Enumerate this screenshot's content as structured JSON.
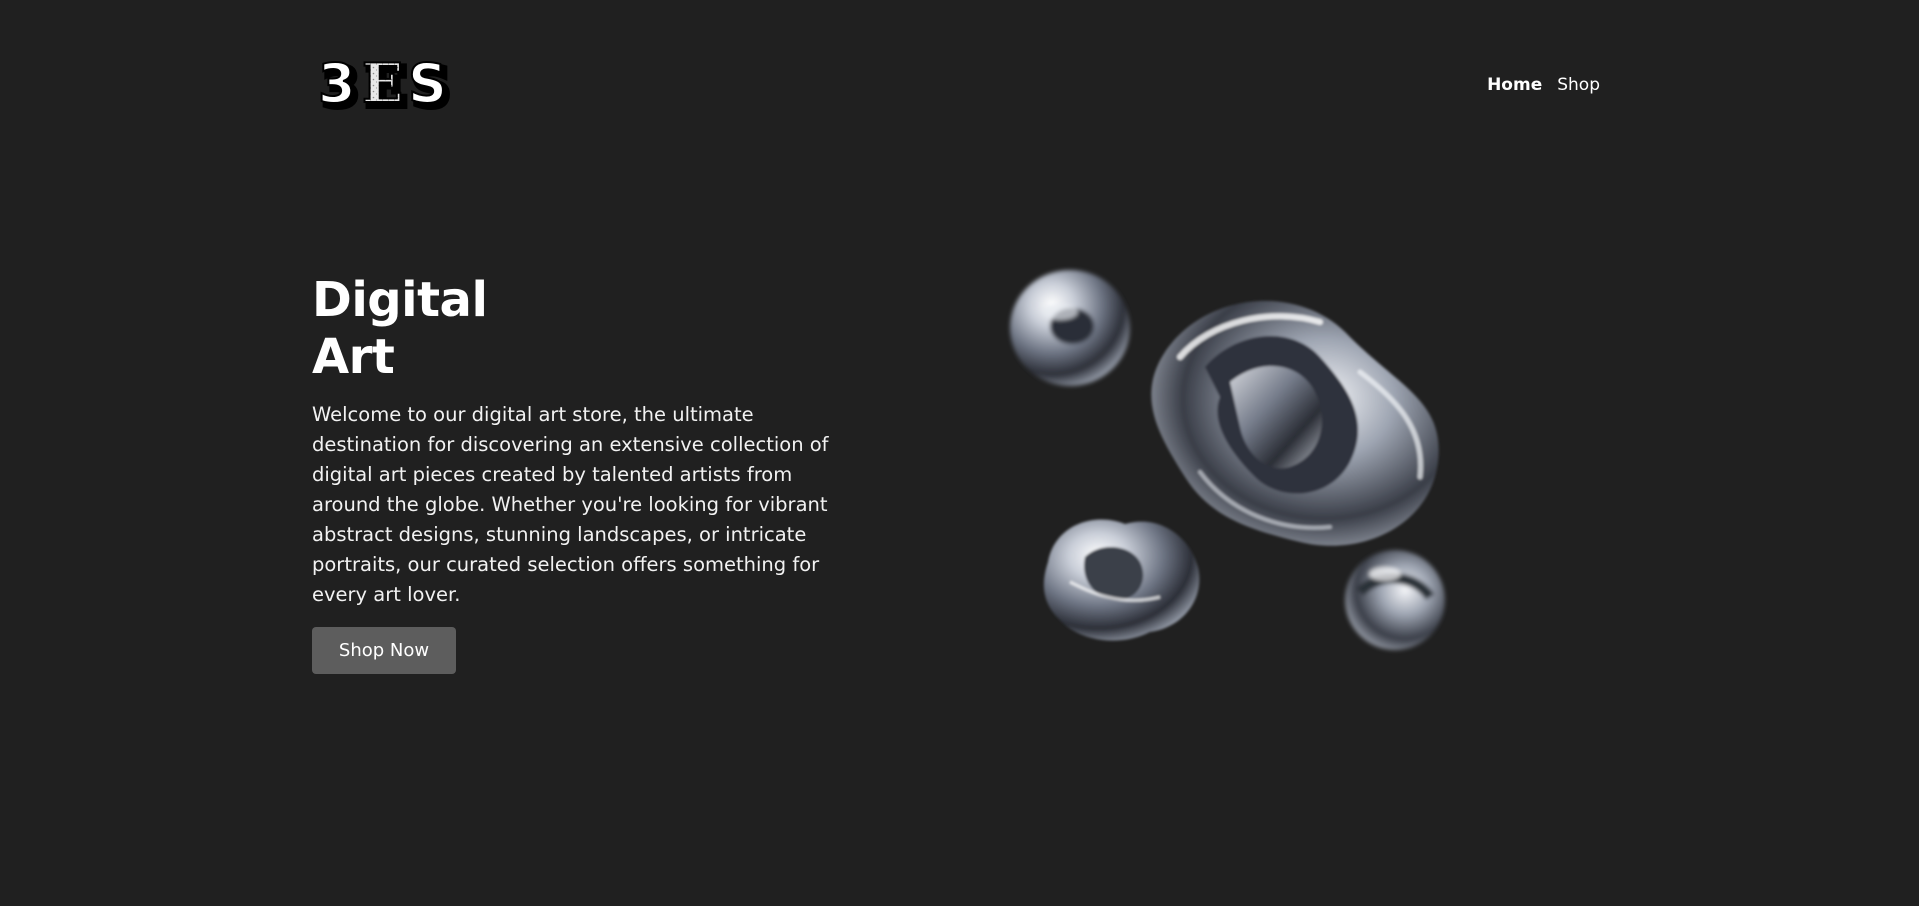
{
  "header": {
    "logo_text": "3ES",
    "nav": [
      {
        "label": "Home",
        "active": true
      },
      {
        "label": "Shop",
        "active": false
      }
    ]
  },
  "hero": {
    "title_line1": "Digital",
    "title_line2": "Art",
    "description": "Welcome to our digital art store, the ultimate destination for discovering an extensive collection of digital art pieces created by talented artists from around the globe. Whether you're looking for vibrant abstract designs, stunning landscapes, or intricate portraits, our curated selection offers something for every art lover.",
    "cta_label": "Shop Now",
    "art_icon": "chrome-abstract-shapes"
  },
  "colors": {
    "background": "#202020",
    "text": "#ffffff",
    "button": "#5d5d5d"
  }
}
